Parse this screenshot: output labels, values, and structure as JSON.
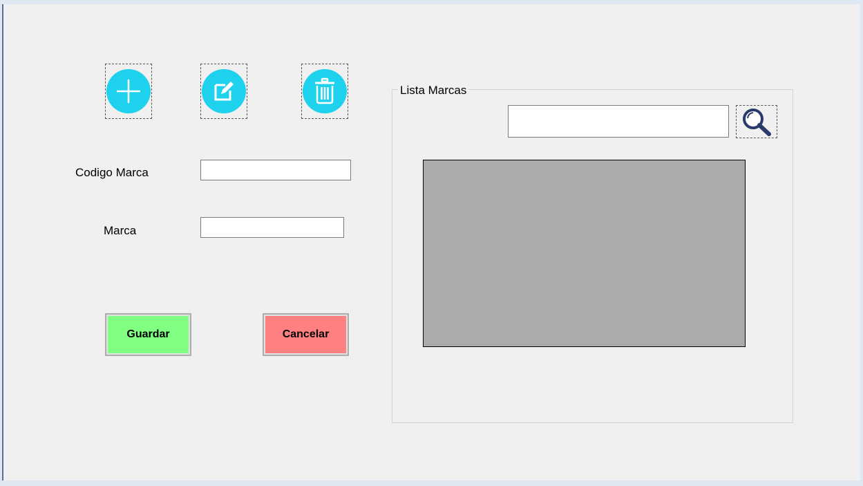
{
  "toolbar": {
    "add_icon": "plus-icon",
    "edit_icon": "edit-icon",
    "delete_icon": "trash-icon",
    "icon_color": "#1ed2ee"
  },
  "form": {
    "codigo_label": "Codigo Marca",
    "codigo_value": "",
    "marca_label": "Marca",
    "marca_value": ""
  },
  "actions": {
    "guardar_label": "Guardar",
    "guardar_color": "#80ff80",
    "cancelar_label": "Cancelar",
    "cancelar_color": "#ff8080"
  },
  "list": {
    "group_title": "Lista Marcas",
    "search_value": "",
    "search_icon": "magnifier-icon"
  }
}
